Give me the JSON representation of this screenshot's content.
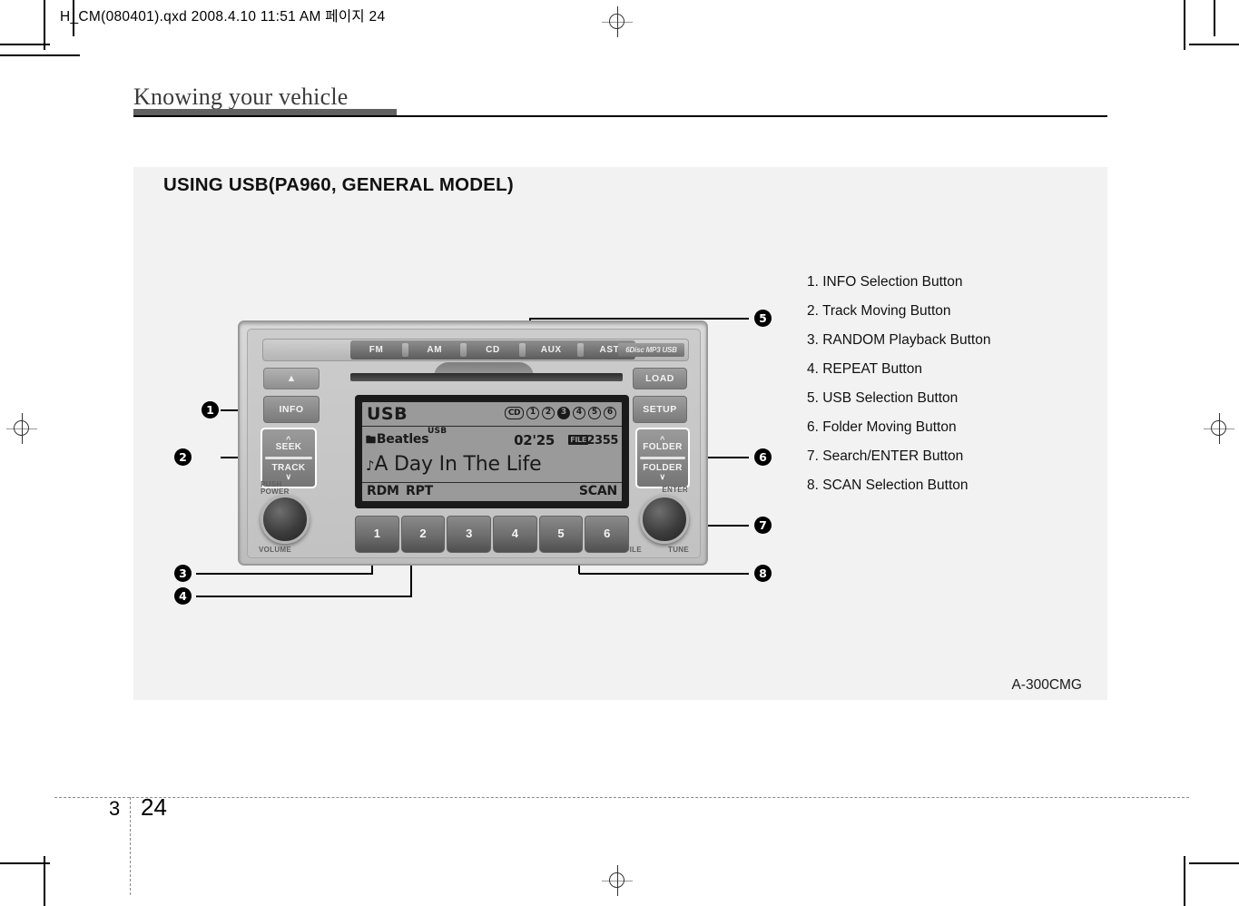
{
  "print": {
    "file_header": "H_CM(080401).qxd  2008.4.10 11:51 AM 페이지 24"
  },
  "chapter": {
    "title": "Knowing your vehicle"
  },
  "panel": {
    "title": "USING USB(PA960, GENERAL MODEL)",
    "figure_code": "A-300CMG"
  },
  "legend": {
    "items": [
      "1. INFO Selection Button",
      "2. Track Moving Button",
      "3. RANDOM Playback Button",
      "4. REPEAT Button",
      "5. USB Selection Button",
      "6. Folder Moving Button",
      "7. Search/ENTER Button",
      "8. SCAN Selection Button"
    ]
  },
  "callouts": {
    "c1": "1",
    "c2": "2",
    "c3": "3",
    "c4": "4",
    "c5": "5",
    "c6": "6",
    "c7": "7",
    "c8": "8"
  },
  "radio": {
    "bands": [
      "FM",
      "AM",
      "CD",
      "AUX",
      "AST"
    ],
    "disc_logo": "6Disc MP3 USB",
    "eject_label": "▲",
    "load_label": "LOAD",
    "info_label": "INFO",
    "setup_label": "SETUP",
    "seek_label": "SEEK",
    "track_label": "TRACK",
    "folder_up_label": "FOLDER",
    "folder_down_label": "FOLDER",
    "power_label_1": "PUSH",
    "power_label_2": "POWER",
    "volume_label": "VOLUME",
    "enter_label": "ENTER",
    "file_label": "FILE",
    "tune_label": "TUNE",
    "presets": [
      "1",
      "2",
      "3",
      "4",
      "5",
      "6"
    ]
  },
  "lcd": {
    "source": "USB",
    "cd_badge": "CD",
    "disc_indicators": [
      "1",
      "2",
      "3",
      "4",
      "5",
      "6"
    ],
    "active_disc": "3",
    "folder_name": "Beatles",
    "usb_tag": "USB",
    "elapsed_time": "02'25",
    "file_badge": "FILE",
    "file_number": "2355",
    "track_title": "A Day In The Life",
    "mode_rdm": "RDM",
    "mode_rpt": "RPT",
    "mode_scan": "SCAN"
  },
  "footer": {
    "chapter_number": "3",
    "page_number": "24"
  }
}
